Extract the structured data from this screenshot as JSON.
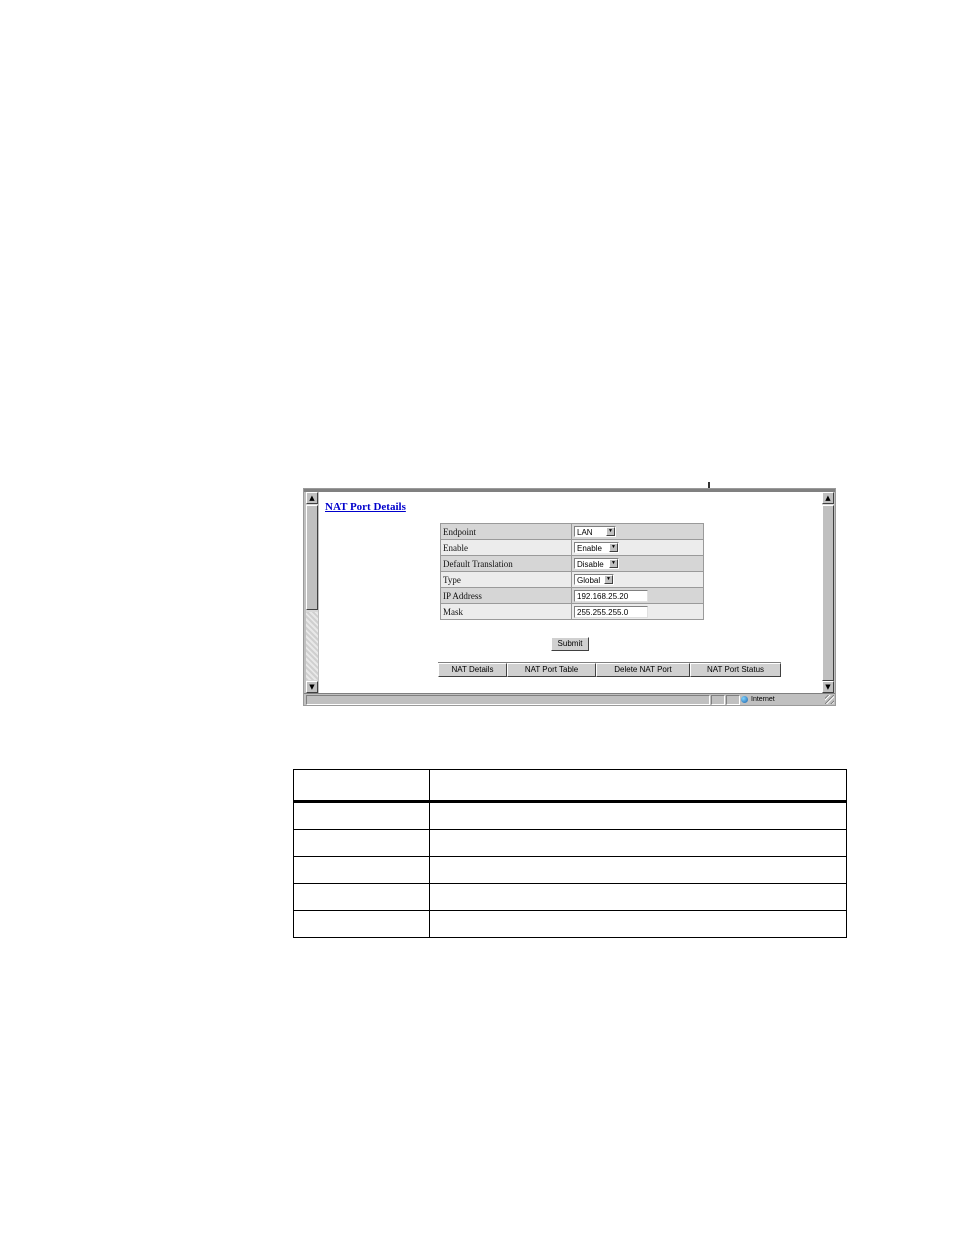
{
  "window": {
    "page_title": "NAT Port Details",
    "fields": [
      {
        "label": "Endpoint",
        "kind": "select",
        "value": "LAN"
      },
      {
        "label": "Enable",
        "kind": "select",
        "value": "Enable"
      },
      {
        "label": "Default Translation",
        "kind": "select",
        "value": "Disable"
      },
      {
        "label": "Type",
        "kind": "select",
        "value": "Global"
      },
      {
        "label": "IP Address",
        "kind": "text",
        "value": "192.168.25.20"
      },
      {
        "label": "Mask",
        "kind": "text",
        "value": "255.255.255.0"
      }
    ],
    "submit_label": "Submit",
    "nav_buttons": [
      "NAT Details",
      "NAT Port Table",
      "Delete NAT Port",
      "NAT Port Status"
    ],
    "status_zone": "Internet"
  },
  "doc_table": {
    "columns": 2,
    "rows": 5,
    "cells": []
  }
}
